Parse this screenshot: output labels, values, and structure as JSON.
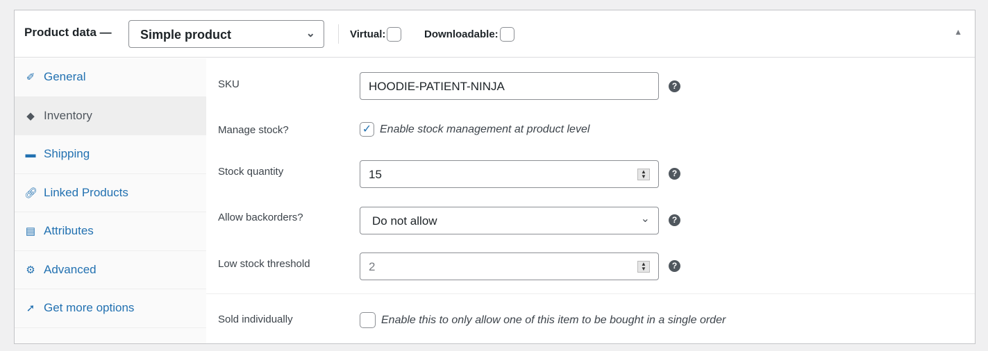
{
  "header": {
    "title": "Product data —",
    "product_type": "Simple product",
    "virtual_label": "Virtual:",
    "virtual_checked": false,
    "downloadable_label": "Downloadable:",
    "downloadable_checked": false
  },
  "sidebar": {
    "active": "Inventory",
    "items": [
      {
        "label": "General",
        "icon": "wrench-icon"
      },
      {
        "label": "Inventory",
        "icon": "tag-icon"
      },
      {
        "label": "Shipping",
        "icon": "truck-icon"
      },
      {
        "label": "Linked Products",
        "icon": "link-icon"
      },
      {
        "label": "Attributes",
        "icon": "list-icon"
      },
      {
        "label": "Advanced",
        "icon": "gear-icon"
      },
      {
        "label": "Get more options",
        "icon": "plugin-icon"
      }
    ]
  },
  "inventory": {
    "sku_label": "SKU",
    "sku_value": "HOODIE-PATIENT-NINJA",
    "manage_stock_label": "Manage stock?",
    "manage_stock_desc": "Enable stock management at product level",
    "manage_stock_checked": true,
    "stock_qty_label": "Stock quantity",
    "stock_qty_value": "15",
    "backorders_label": "Allow backorders?",
    "backorders_value": "Do not allow",
    "low_stock_label": "Low stock threshold",
    "low_stock_value": "2",
    "sold_individually_label": "Sold individually",
    "sold_individually_desc": "Enable this to only allow one of this item to be bought in a single order",
    "sold_individually_checked": false,
    "help": "?"
  },
  "colors": {
    "link": "#2271b1",
    "active_tab_bg": "#eeeeee"
  }
}
